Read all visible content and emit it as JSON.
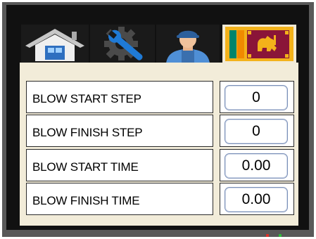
{
  "tabs": [
    {
      "icon": "home-icon"
    },
    {
      "icon": "settings-icon"
    },
    {
      "icon": "operator-icon"
    },
    {
      "icon": "sri-lanka-flag-icon"
    }
  ],
  "parameters": [
    {
      "label": "BLOW START STEP",
      "value": "0"
    },
    {
      "label": "BLOW FINISH STEP",
      "value": "0"
    },
    {
      "label": "BLOW START TIME",
      "value": "0.00"
    },
    {
      "label": "BLOW FINISH TIME",
      "value": "0.00"
    }
  ],
  "colors": {
    "bezel": "#595959",
    "screen": "#111111",
    "panel": "#f2ecd9",
    "accent_blue": "#1f7ad6",
    "led_red": "#e0302a",
    "led_green": "#2fbf3a"
  }
}
